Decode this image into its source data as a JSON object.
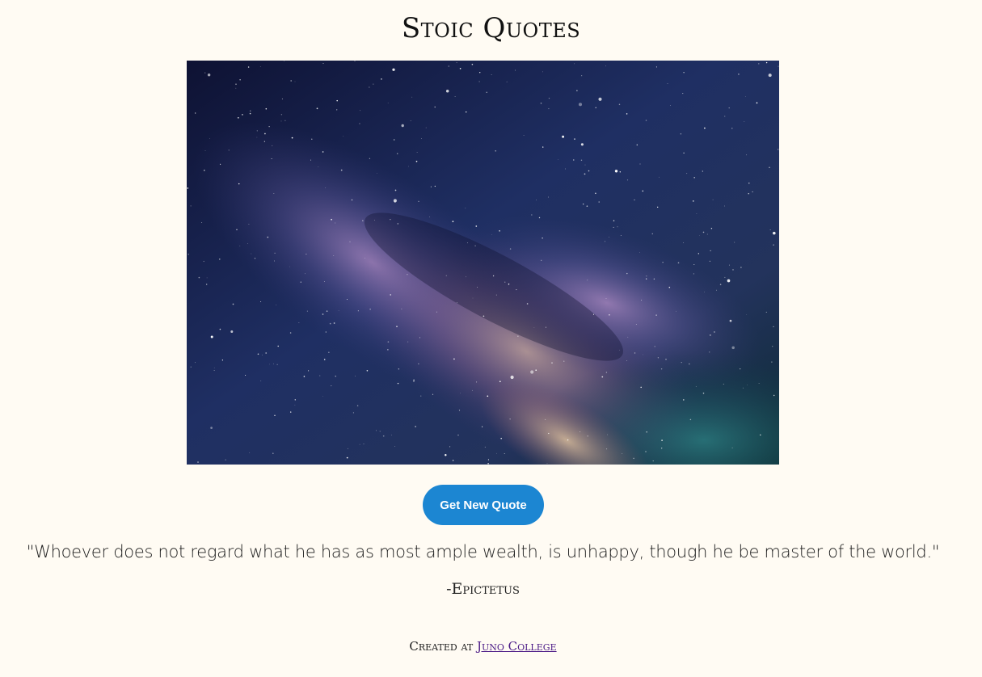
{
  "page": {
    "title": "Stoic Quotes",
    "background_color": "#fffbf3"
  },
  "hero_image": {
    "description_icon": "milky-way-night-sky-image"
  },
  "actions": {
    "new_quote_label": "Get New Quote",
    "button_color": "#1c86d2"
  },
  "quote": {
    "text": "\"Whoever does not regard what he has as most ample wealth, is unhappy, though he be master of the world.\"",
    "author": "-Epictetus"
  },
  "footer": {
    "prefix": "Created at ",
    "link_label": "Juno College",
    "link_color": "#4b1a86"
  }
}
